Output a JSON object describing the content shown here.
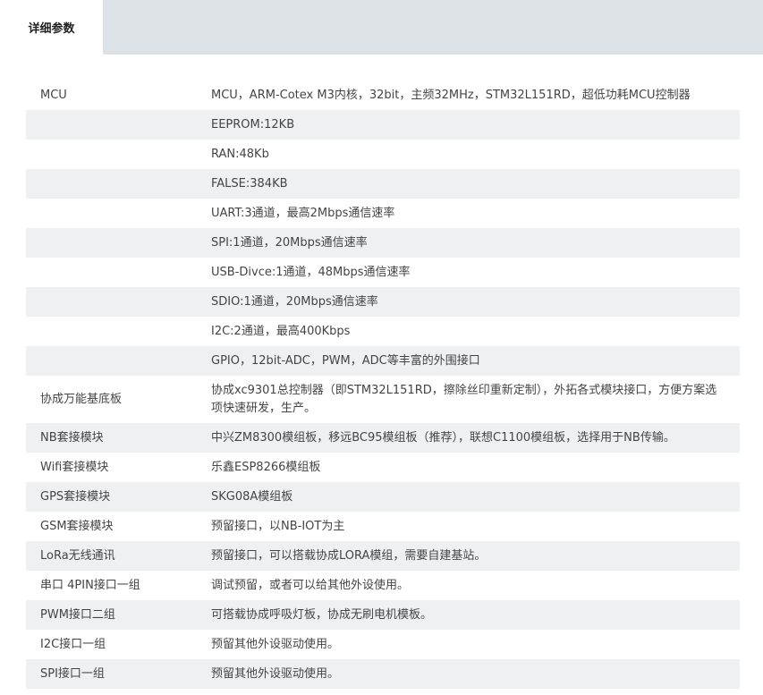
{
  "tabs": {
    "active_label": "详细参数"
  },
  "specs": [
    {
      "key": "MCU",
      "value": "MCU，ARM-Cotex M3内核，32bit，主频32MHz，STM32L151RD，超低功耗MCU控制器"
    },
    {
      "key": "",
      "value": "EEPROM:12KB"
    },
    {
      "key": "",
      "value": "RAN:48Kb"
    },
    {
      "key": "",
      "value": "FALSE:384KB"
    },
    {
      "key": "",
      "value": "UART:3通道，最高2Mbps通信速率"
    },
    {
      "key": "",
      "value": "SPI:1通道，20Mbps通信速率"
    },
    {
      "key": "",
      "value": "USB-Divce:1通道，48Mbps通信速率"
    },
    {
      "key": "",
      "value": "SDIO:1通道，20Mbps通信速率"
    },
    {
      "key": "",
      "value": "I2C:2通道，最高400Kbps"
    },
    {
      "key": "",
      "value": "GPIO，12bit-ADC，PWM，ADC等丰富的外围接口"
    },
    {
      "key": "协成万能基底板",
      "value": "协成xc9301总控制器（即STM32L151RD，擦除丝印重新定制），外拓各式模块接口，方便方案选项快速研发，生产。"
    },
    {
      "key": "NB套接模块",
      "value": "中兴ZM8300模组板，移远BC95模组板（推荐），联想C1100模组板，选择用于NB传输。"
    },
    {
      "key": "Wifi套接模块",
      "value": "乐鑫ESP8266模组板"
    },
    {
      "key": "GPS套接模块",
      "value": "SKG08A模组板"
    },
    {
      "key": "GSM套接模块",
      "value": "预留接口，以NB-IOT为主"
    },
    {
      "key": "LoRa无线通讯",
      "value": "预留接口，可以搭载协成LORA模组，需要自建基站。"
    },
    {
      "key": "串口 4PIN接口一组",
      "value": "调试预留，或者可以给其他外设使用。"
    },
    {
      "key": "PWM接口二组",
      "value": "可搭载协成呼吸灯板，协成无刷电机模板。"
    },
    {
      "key": "I2C接口一组",
      "value": "预留其他外设驱动使用。"
    },
    {
      "key": "SPI接口一组",
      "value": "预留其他外设驱动使用。"
    }
  ]
}
